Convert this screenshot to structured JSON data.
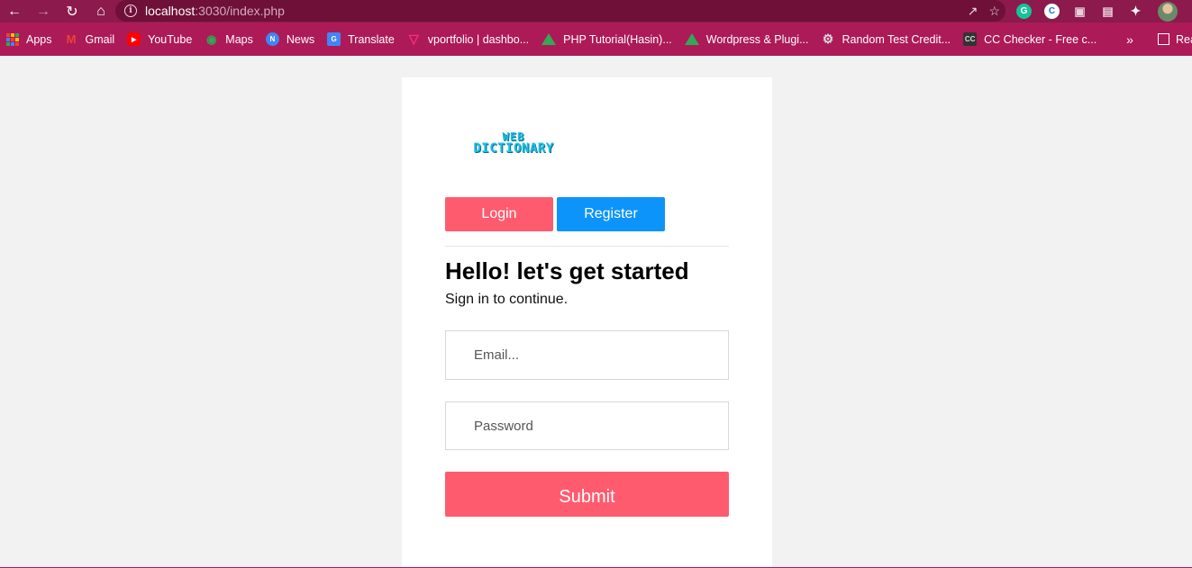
{
  "browser": {
    "url_host": "localhost",
    "url_path": ":3030/index.php",
    "bookmarks": [
      {
        "label": "Apps",
        "icon": "apps-grid-icon"
      },
      {
        "label": "Gmail",
        "icon": "gmail-icon"
      },
      {
        "label": "YouTube",
        "icon": "youtube-icon"
      },
      {
        "label": "Maps",
        "icon": "maps-icon"
      },
      {
        "label": "News",
        "icon": "news-icon"
      },
      {
        "label": "Translate",
        "icon": "translate-icon"
      },
      {
        "label": "vportfolio | dashbo...",
        "icon": "vportfolio-icon"
      },
      {
        "label": "PHP Tutorial(Hasin)...",
        "icon": "google-drive-icon"
      },
      {
        "label": "Wordpress & Plugi...",
        "icon": "google-drive-icon"
      },
      {
        "label": "Random Test Credit...",
        "icon": "gear-icon"
      },
      {
        "label": "CC Checker - Free c...",
        "icon": "cc-checker-icon"
      }
    ],
    "more_label": "»",
    "reading_list_label": "Reading",
    "colors": {
      "toolbar": "#8c1a4c",
      "bookmarks_bar": "#ad1a58"
    }
  },
  "page": {
    "logo_line1": "WEB",
    "logo_line2": "DICTIONARY",
    "login_tab": "Login",
    "register_tab": "Register",
    "heading": "Hello! let's get started",
    "subheading": "Sign in to continue.",
    "email_placeholder": "Email...",
    "password_placeholder": "Password",
    "submit_label": "Submit",
    "colors": {
      "primary": "#ff5b6e",
      "secondary": "#0d94fb",
      "logo": "#1cbfe6",
      "background": "#f2f2f2"
    }
  }
}
